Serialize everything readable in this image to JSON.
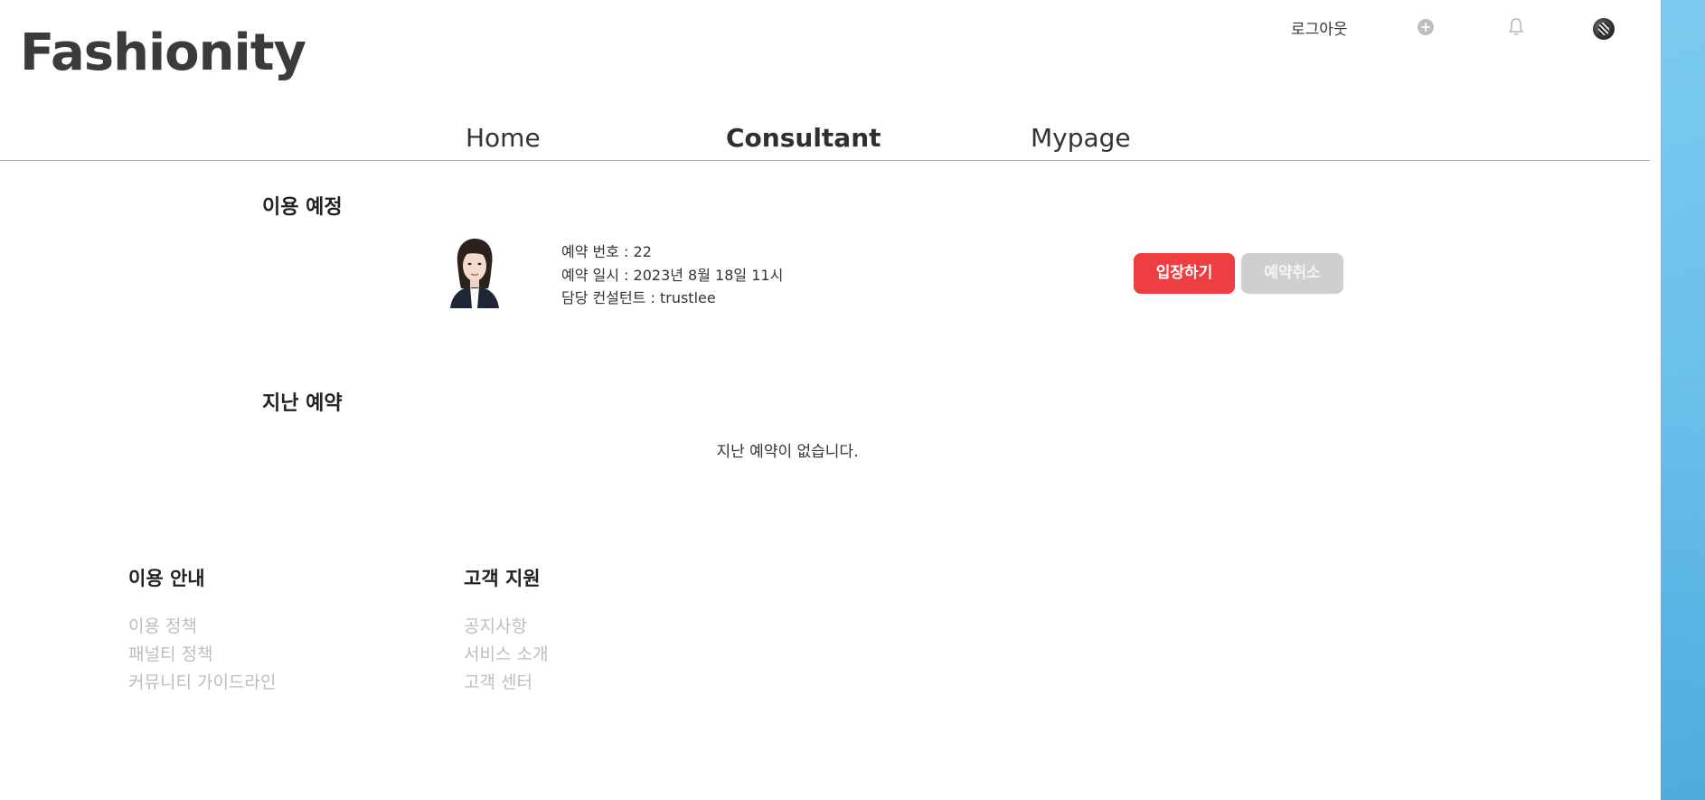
{
  "app": {
    "logo": "Fashionity"
  },
  "header": {
    "logout_label": "로그아웃",
    "plus_icon": "plus-circle-icon",
    "bell_icon": "bell-icon",
    "avatar_icon": "user-avatar-icon"
  },
  "nav": {
    "items": [
      {
        "label": "Home",
        "active": false
      },
      {
        "label": "Consultant",
        "active": true
      },
      {
        "label": "Mypage",
        "active": false
      }
    ]
  },
  "upcoming": {
    "title": "이용 예정",
    "reservation": {
      "number_line": "예약 번호 : 22",
      "datetime_line": "예약 일시 : 2023년 8월 18일 11시",
      "consultant_line": "담당 컨설턴트 : trustlee",
      "enter_label": "입장하기",
      "cancel_label": "예약취소"
    }
  },
  "past": {
    "title": "지난 예약",
    "empty_message": "지난 예약이 없습니다."
  },
  "footer": {
    "guide": {
      "title": "이용 안내",
      "links": [
        "이용 정책",
        "패널티 정책",
        "커뮤니티 가이드라인"
      ]
    },
    "support": {
      "title": "고객 지원",
      "links": [
        "공지사항",
        "서비스 소개",
        "고객 센터"
      ]
    }
  },
  "colors": {
    "accent_red": "#ee3e41",
    "disabled_gray": "#cfcfcf",
    "side_panel_blue": "#6cc2ec"
  }
}
